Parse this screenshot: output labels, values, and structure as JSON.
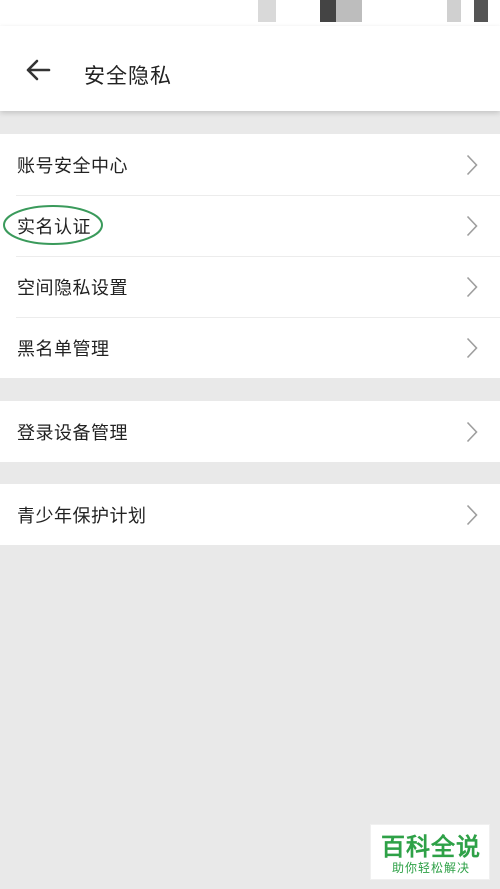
{
  "header": {
    "title": "安全隐私",
    "back_icon": "arrow-left-icon"
  },
  "groups": [
    {
      "items": [
        {
          "label": "账号安全中心"
        },
        {
          "label": "实名认证",
          "highlighted": true
        },
        {
          "label": "空间隐私设置"
        },
        {
          "label": "黑名单管理"
        }
      ]
    },
    {
      "items": [
        {
          "label": "登录设备管理"
        }
      ]
    },
    {
      "items": [
        {
          "label": "青少年保护计划"
        }
      ]
    }
  ],
  "watermark": {
    "title": "百科全说",
    "subtitle": "助你轻松解决"
  },
  "colors": {
    "background": "#e9e9e9",
    "card": "#ffffff",
    "text": "#222222",
    "chevron": "#9e9e9e",
    "highlight": "#3a9a5b",
    "watermark_green": "#2ea147"
  }
}
